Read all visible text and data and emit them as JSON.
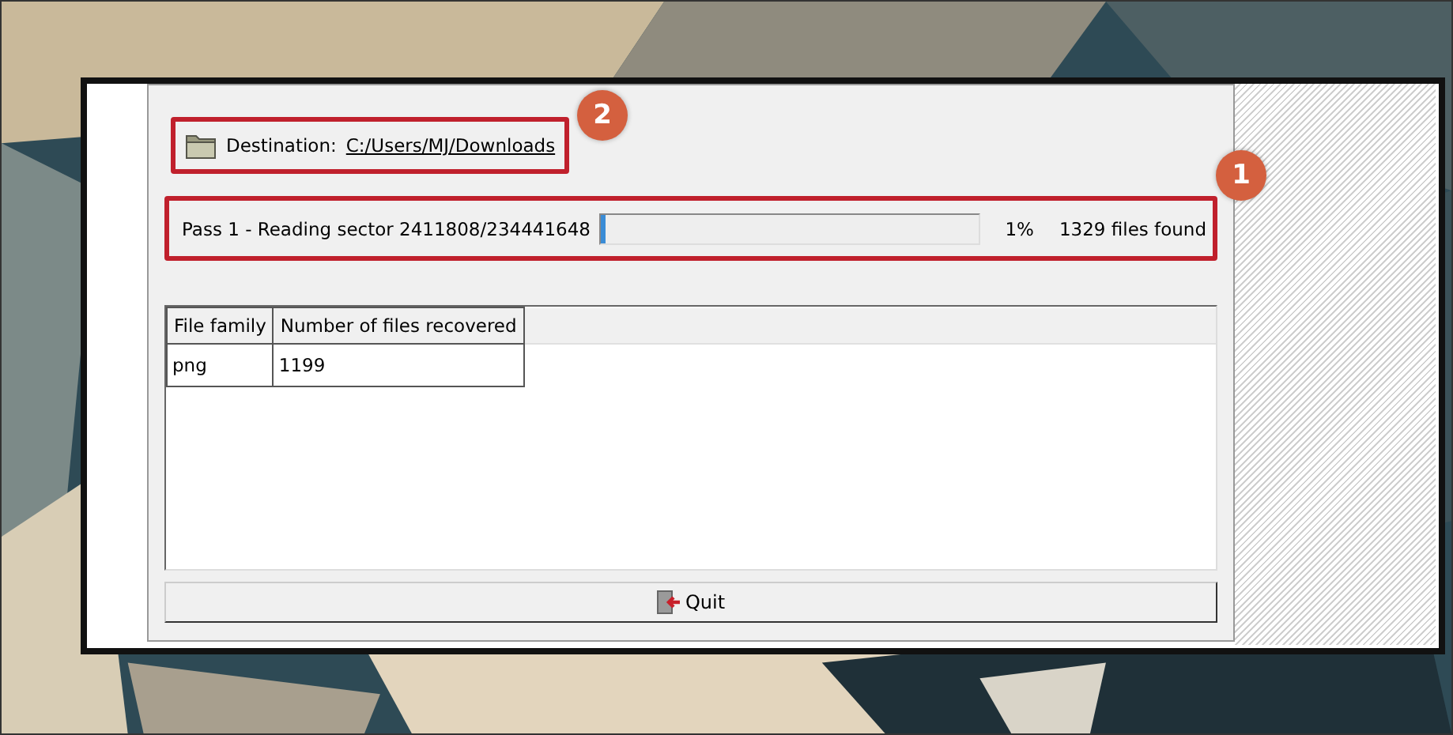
{
  "destination": {
    "label": "Destination:",
    "path": "C:/Users/MJ/Downloads",
    "callout": "2"
  },
  "progress": {
    "status": "Pass 1 - Reading sector 2411808/234441648",
    "level": 0.01,
    "percent": "1%",
    "found": "1329 files found",
    "callout": "1"
  },
  "table": {
    "columns": [
      "File family",
      "Number of files recovered"
    ],
    "rows": [
      [
        "png",
        "1199"
      ]
    ]
  },
  "buttons": [
    {
      "label": "Quit",
      "kind": "quit"
    }
  ]
}
